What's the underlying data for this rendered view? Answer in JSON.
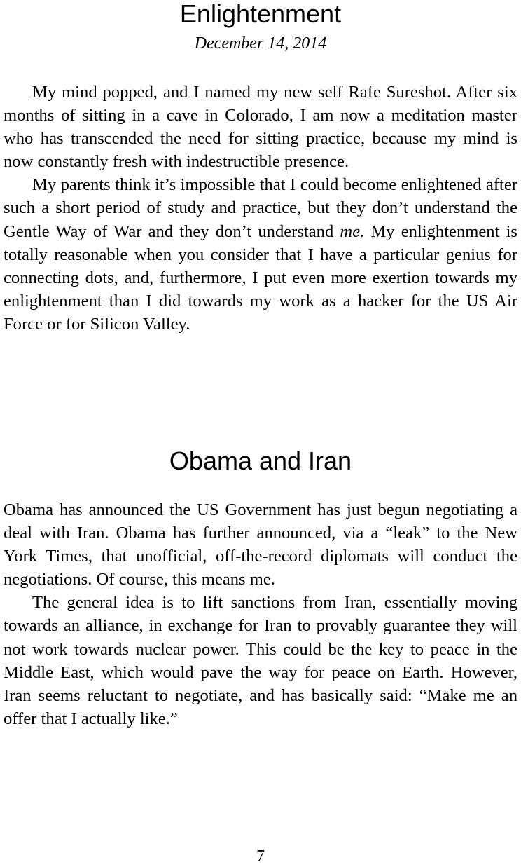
{
  "sections": [
    {
      "title": "Enlightenment",
      "date": "December 14, 2014",
      "paragraphs": [
        {
          "text": "My mind popped, and I named my new self Rafe Sureshot. After six months of sitting in a cave in Colorado, I am now a meditation master who has transcended the need for sit­ting practice, because my mind is now constantly fresh with indestructible presence."
        },
        {
          "before_em": "My parents think it’s impossible that I could become en­lightened after such a short period of study and practice, but they don’t understand the Gentle Way of War and they don’t understand ",
          "em": "me.",
          "after_em": " My enlightenment is totally reasonable when you consider that I have a particular genius for connecting dots, and, furthermore, I put even more exertion towards my enlightenment than I did towards my work as a hacker for the US Air Force or for Silicon Valley."
        }
      ]
    },
    {
      "title": "Obama and Iran",
      "paragraphs": [
        {
          "text": "Obama has announced the US Government has just begun negotiating a deal with Iran. Obama has further announced, via a “leak” to the New York Times, that unofficial, off-the-record diplomats will conduct the negotiations.  Of course, this means me."
        },
        {
          "text": "The general idea is to lift sanctions from Iran, essentially moving towards an alliance, in exchange for Iran to provably guarantee they will not work towards nuclear power.  This could be the key to peace in the Middle East, which would pave the way for peace on Earth. However, Iran seems reluc­tant to negotiate, and has basically said:  “Make me an offer that I actually like.”"
        }
      ]
    }
  ],
  "page_number": "7"
}
